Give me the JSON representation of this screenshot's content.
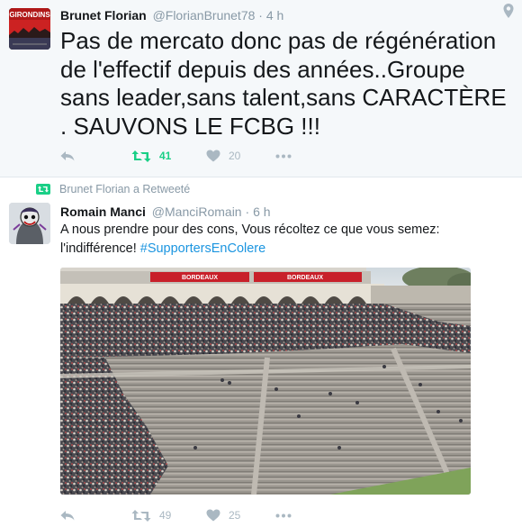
{
  "tweet1": {
    "author_name": "Brunet Florian",
    "author_handle": "@FlorianBrunet78",
    "separator": "·",
    "time": "4 h",
    "avatar_text": "GIRONDINS",
    "text": "Pas de mercato donc pas de régénération de l'effectif depuis des années..Groupe sans leader,sans talent,sans CARACTÈRE . SAUVONS LE FCBG !!!",
    "retweet_count": "41",
    "like_count": "20"
  },
  "retweet_banner": {
    "label": "Brunet Florian a Retweeté"
  },
  "tweet2": {
    "author_name": "Romain Manci",
    "author_handle": "@ManciRomain",
    "separator": "·",
    "time": "6 h",
    "text_main": "A nous prendre pour des cons,  Vous récoltez ce que vous semez: l'indifférence! ",
    "hashtag": "#SupportersEnColere",
    "photo_banner_1": "BORDEAUX",
    "photo_banner_2": "BORDEAUX",
    "retweet_count": "49",
    "like_count": "25"
  },
  "icons": {
    "reply": "reply-icon",
    "retweet": "retweet-icon",
    "like": "heart-icon",
    "more": "more-icon",
    "location": "location-pin-icon"
  },
  "colors": {
    "retweet_active": "#19cf86",
    "hashtag": "#1b95e0",
    "muted": "#8899a6",
    "action_gray": "#aab8c2"
  }
}
